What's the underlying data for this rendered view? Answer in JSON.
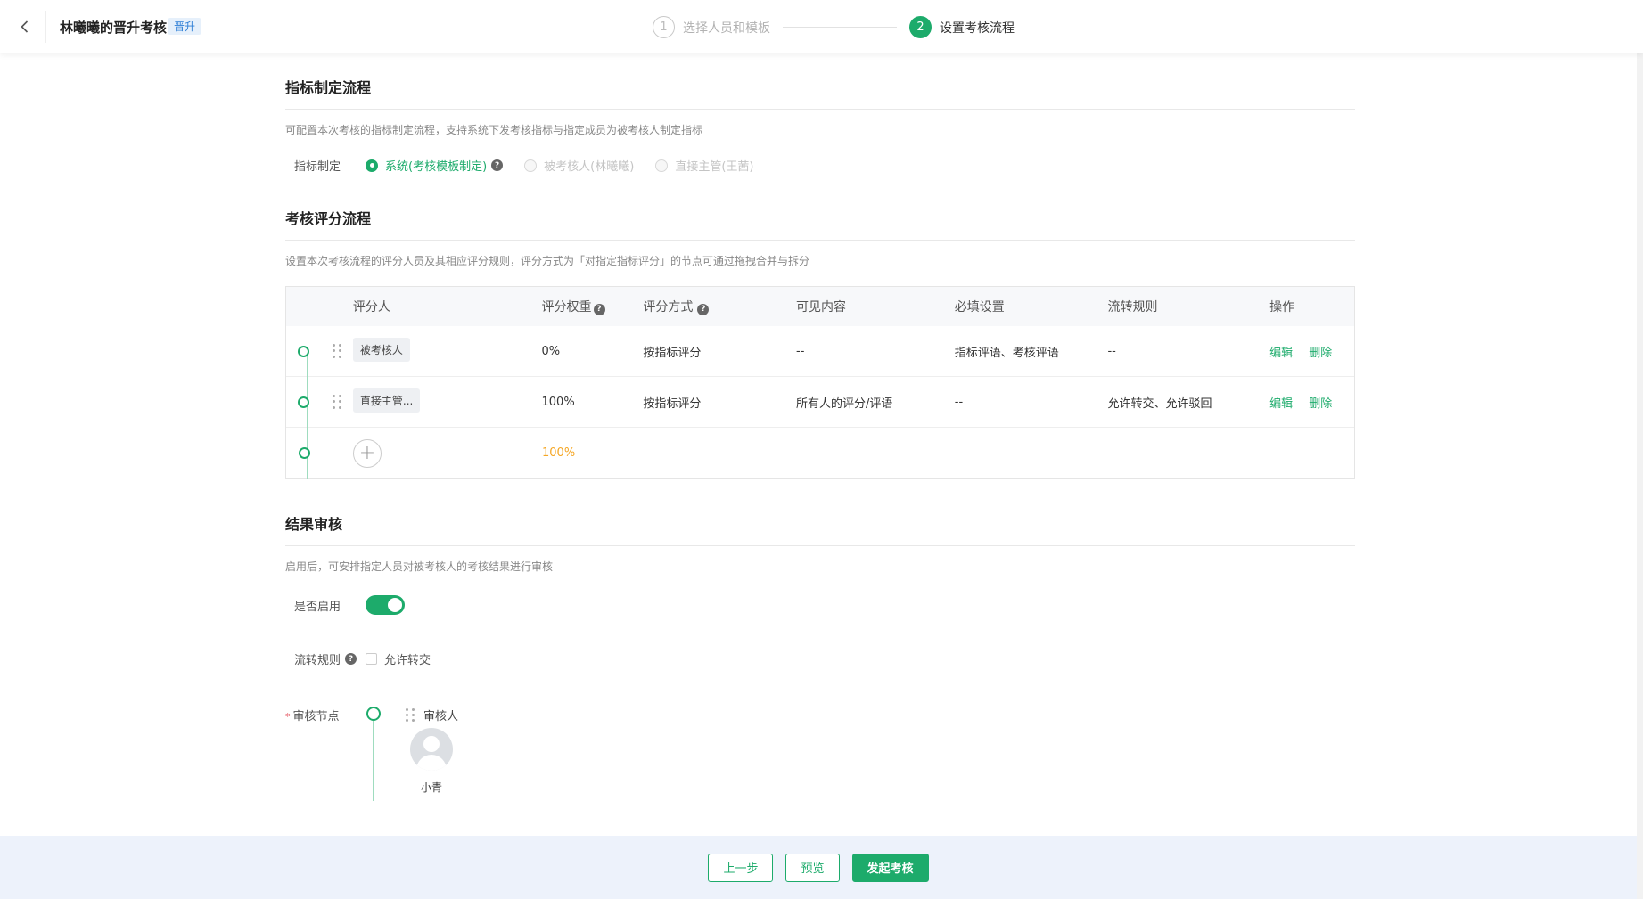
{
  "header": {
    "title": "林曦曦的晋升考核",
    "tag": "晋升",
    "steps": [
      {
        "num": "1",
        "label": "选择人员和模板"
      },
      {
        "num": "2",
        "label": "设置考核流程"
      }
    ]
  },
  "indicator_section": {
    "title": "指标制定流程",
    "desc": "可配置本次考核的指标制定流程，支持系统下发考核指标与指定成员为被考核人制定指标",
    "row_label": "指标制定",
    "options": [
      {
        "label": "系统(考核模板制定)",
        "checked": true
      },
      {
        "label": "被考核人(林曦曦)",
        "checked": false
      },
      {
        "label": "直接主管(王茜)",
        "checked": false
      }
    ]
  },
  "scoring_section": {
    "title": "考核评分流程",
    "desc": "设置本次考核流程的评分人员及其相应评分规则，评分方式为「对指定指标评分」的节点可通过拖拽合并与拆分",
    "columns": {
      "rater": "评分人",
      "weight": "评分权重",
      "method": "评分方式",
      "visible": "可见内容",
      "required": "必填设置",
      "rule": "流转规则",
      "op": "操作"
    },
    "rows": [
      {
        "rater": "被考核人",
        "weight": "0%",
        "method": "按指标评分",
        "visible": "--",
        "required": "指标评语、考核评语",
        "rule": "--",
        "edit": "编辑",
        "delete": "删除"
      },
      {
        "rater": "直接主管...",
        "weight": "100%",
        "method": "按指标评分",
        "visible": "所有人的评分/评语",
        "required": "--",
        "rule": "允许转交、允许驳回",
        "edit": "编辑",
        "delete": "删除"
      }
    ],
    "total_weight": "100%",
    "add_symbol": "+"
  },
  "review_section": {
    "title": "结果审核",
    "desc": "启用后，可安排指定人员对被考核人的考核结果进行审核",
    "enable_label": "是否启用",
    "enabled": true,
    "rule_label": "流转规则",
    "allow_transfer": "允许转交",
    "node_label": "审核节点",
    "node_required_mark": "*",
    "reviewer_title": "审核人",
    "reviewer_name": "小青"
  },
  "footer": {
    "prev": "上一步",
    "preview": "预览",
    "submit": "发起考核"
  },
  "colors": {
    "accent": "#1dab6b",
    "warning": "#f5a623",
    "tag_blue": "#2f7fd6"
  }
}
